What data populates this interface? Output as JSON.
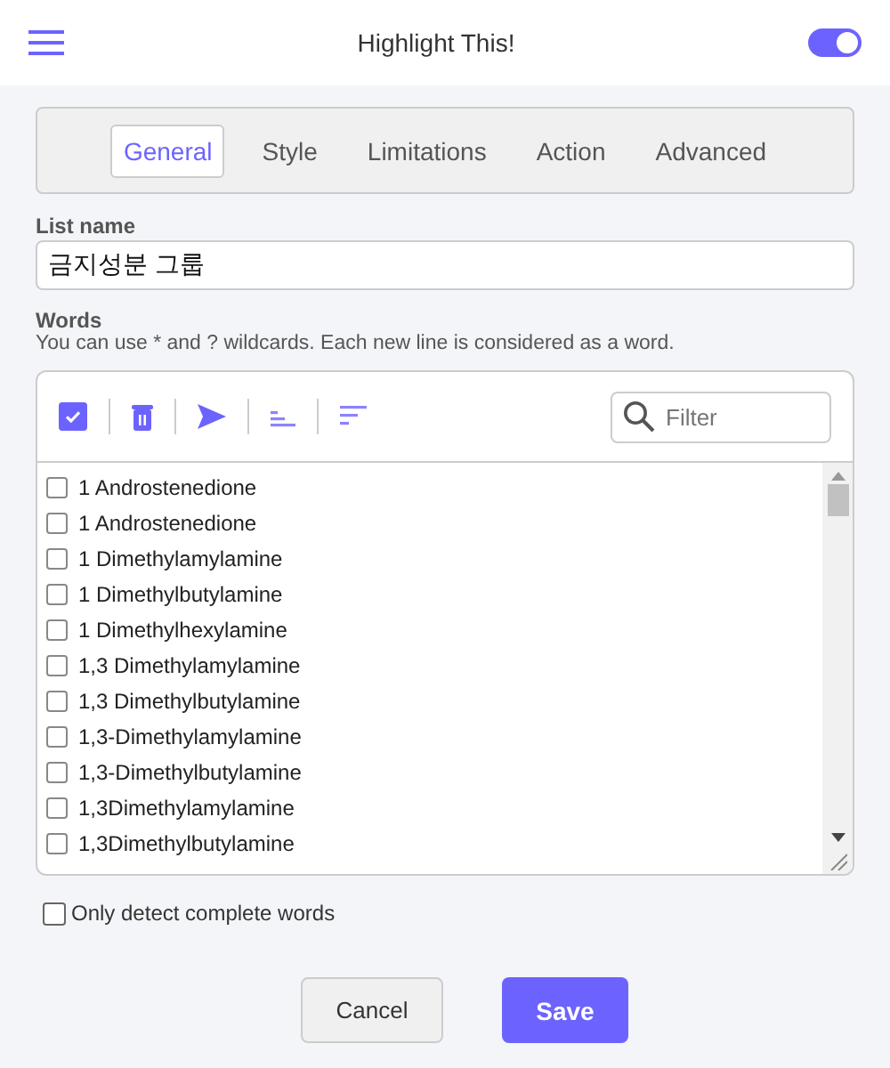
{
  "header": {
    "title": "Highlight This!",
    "enabled": true
  },
  "tabs": [
    {
      "label": "General",
      "selected": true
    },
    {
      "label": "Style",
      "selected": false
    },
    {
      "label": "Limitations",
      "selected": false
    },
    {
      "label": "Action",
      "selected": false
    },
    {
      "label": "Advanced",
      "selected": false
    }
  ],
  "list_name": {
    "label": "List name",
    "value": "금지성분 그룹"
  },
  "words": {
    "label": "Words",
    "hint": "You can use * and ? wildcards. Each new line is considered as a word.",
    "filter": {
      "placeholder": "Filter"
    },
    "items": [
      {
        "text": "1 Androstenedione",
        "checked": false
      },
      {
        "text": "1 Androstenedione",
        "checked": false
      },
      {
        "text": "1 Dimethylamylamine",
        "checked": false
      },
      {
        "text": "1 Dimethylbutylamine",
        "checked": false
      },
      {
        "text": "1 Dimethylhexylamine",
        "checked": false
      },
      {
        "text": "1,3 Dimethylamylamine",
        "checked": false
      },
      {
        "text": "1,3 Dimethylbutylamine",
        "checked": false
      },
      {
        "text": "1,3-Dimethylamylamine",
        "checked": false
      },
      {
        "text": "1,3-Dimethylbutylamine",
        "checked": false
      },
      {
        "text": "1,3Dimethylamylamine",
        "checked": false
      },
      {
        "text": "1,3Dimethylbutylamine",
        "checked": false
      }
    ]
  },
  "complete_words": {
    "label": "Only detect complete words",
    "checked": false
  },
  "buttons": [
    {
      "label": "Cancel",
      "kind": "secondary"
    },
    {
      "label": "Save",
      "kind": "primary"
    }
  ]
}
